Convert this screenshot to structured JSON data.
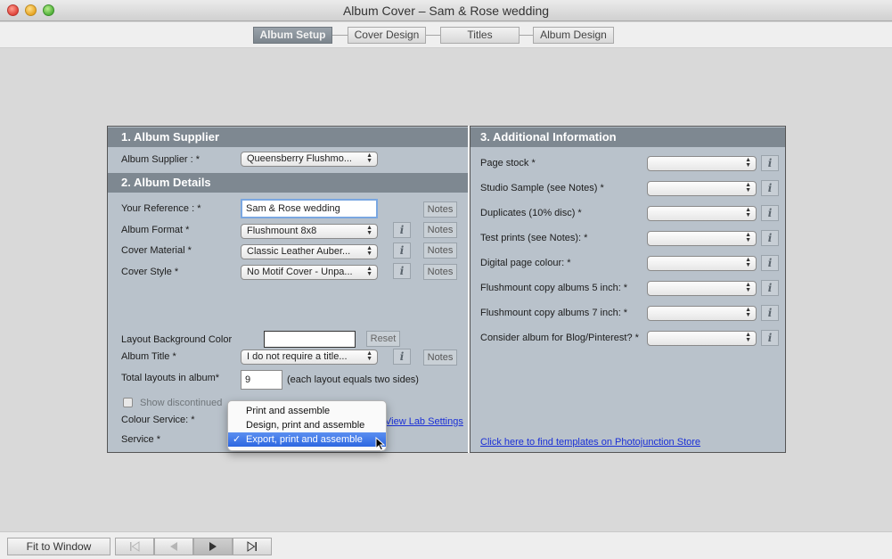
{
  "window": {
    "title": "Album Cover – Sam & Rose wedding"
  },
  "steps": [
    "Album Setup",
    "Cover Design",
    "Titles",
    "Album Design"
  ],
  "left": {
    "section1": "1. Album Supplier",
    "supplier_label": "Album Supplier : *",
    "supplier_value": "Queensberry Flushmo...",
    "section2": "2. Album Details",
    "reference_label": "Your Reference : *",
    "reference_value": "Sam & Rose wedding",
    "format_label": "Album Format *",
    "format_value": "Flushmount 8x8",
    "material_label": "Cover Material *",
    "material_value": "Classic Leather Auber...",
    "style_label": "Cover Style *",
    "style_value": "No Motif Cover - Unpa...",
    "bg_color_label": "Layout Background Color",
    "reset_label": "Reset",
    "album_title_label": "Album Title *",
    "album_title_value": "I do not require a title...",
    "total_layouts_label": "Total layouts in album*",
    "total_layouts_value": "9",
    "total_layouts_note": "(each layout equals two sides)",
    "show_discontinued_label": "Show discontinued",
    "colour_service_label": "Colour Service: *",
    "service_label": "Service *",
    "view_lab_link": "View Lab Settings",
    "notes_label": "Notes",
    "info_label": "i"
  },
  "right": {
    "section3": "3. Additional Information",
    "fields": [
      "Page stock *",
      "Studio Sample (see Notes) *",
      "Duplicates (10% disc) *",
      "Test prints (see Notes): *",
      "Digital page colour: *",
      "Flushmount copy albums 5 inch: *",
      "Flushmount copy albums 7 inch: *",
      "Consider album for Blog/Pinterest? *"
    ],
    "templates_link": "Click here to find templates on Photojunction Store"
  },
  "popup": {
    "items": [
      "Print and assemble",
      "Design, print and assemble",
      "Export, print and assemble"
    ],
    "check": "✓"
  },
  "bottom": {
    "fit_label": "Fit to Window"
  }
}
